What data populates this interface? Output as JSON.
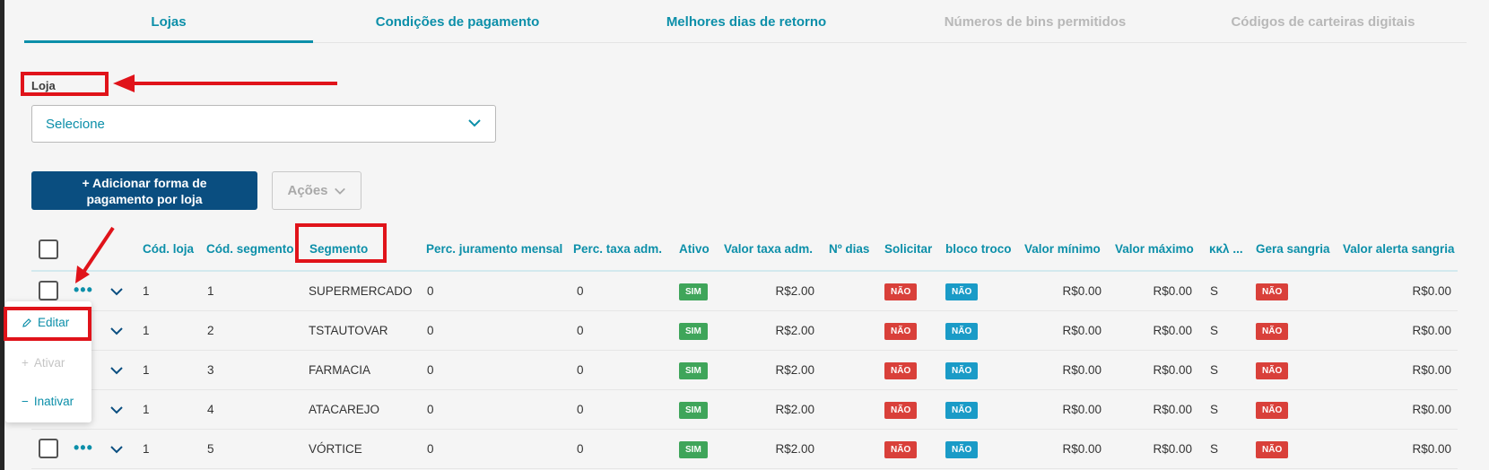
{
  "tabs": [
    {
      "label": "Lojas",
      "state": "active"
    },
    {
      "label": "Condições de pagamento",
      "state": "enabled"
    },
    {
      "label": "Melhores dias de retorno",
      "state": "enabled"
    },
    {
      "label": "Números de bins permitidos",
      "state": "disabled"
    },
    {
      "label": "Códigos de carteiras digitais",
      "state": "disabled"
    }
  ],
  "filter": {
    "label": "Loja",
    "value": "Selecione"
  },
  "actions": {
    "add_label": "+ Adicionar forma de pagamento por loja",
    "actions_label": "Ações"
  },
  "table": {
    "headers": [
      "Cód. loja",
      "Cód. segmento",
      "Segmento",
      "Perc. juramento mensal",
      "Perc. taxa adm.",
      "Ativo",
      "Valor taxa adm.",
      "Nº dias",
      "Solicitar",
      "bloco troco",
      "Valor mínimo",
      "Valor máximo",
      "κκλ ...",
      "Gera sangria",
      "Valor alerta sangria"
    ],
    "rows": [
      {
        "cod_loja": "1",
        "cod_segmento": "1",
        "segmento": "SUPERMERCADO",
        "perc_juramento": "0",
        "perc_taxa": "0",
        "ativo": "SIM",
        "valor_taxa": "R$2.00",
        "solicitar": "NÃO",
        "bloco_troco": "NÃO",
        "valor_minimo": "R$0.00",
        "valor_maximo": "R$0.00",
        "kkl": "S",
        "gera_sangria": "NÃO",
        "valor_alerta": "R$0.00"
      },
      {
        "cod_loja": "1",
        "cod_segmento": "2",
        "segmento": "TSTAUTOVAR",
        "perc_juramento": "0",
        "perc_taxa": "0",
        "ativo": "SIM",
        "valor_taxa": "R$2.00",
        "solicitar": "NÃO",
        "bloco_troco": "NÃO",
        "valor_minimo": "R$0.00",
        "valor_maximo": "R$0.00",
        "kkl": "S",
        "gera_sangria": "NÃO",
        "valor_alerta": "R$0.00"
      },
      {
        "cod_loja": "1",
        "cod_segmento": "3",
        "segmento": "FARMACIA",
        "perc_juramento": "0",
        "perc_taxa": "0",
        "ativo": "SIM",
        "valor_taxa": "R$2.00",
        "solicitar": "NÃO",
        "bloco_troco": "NÃO",
        "valor_minimo": "R$0.00",
        "valor_maximo": "R$0.00",
        "kkl": "S",
        "gera_sangria": "NÃO",
        "valor_alerta": "R$0.00"
      },
      {
        "cod_loja": "1",
        "cod_segmento": "4",
        "segmento": "ATACAREJO",
        "perc_juramento": "0",
        "perc_taxa": "0",
        "ativo": "SIM",
        "valor_taxa": "R$2.00",
        "solicitar": "NÃO",
        "bloco_troco": "NÃO",
        "valor_minimo": "R$0.00",
        "valor_maximo": "R$0.00",
        "kkl": "S",
        "gera_sangria": "NÃO",
        "valor_alerta": "R$0.00"
      },
      {
        "cod_loja": "1",
        "cod_segmento": "5",
        "segmento": "VÓRTICE",
        "perc_juramento": "0",
        "perc_taxa": "0",
        "ativo": "SIM",
        "valor_taxa": "R$2.00",
        "solicitar": "NÃO",
        "bloco_troco": "NÃO",
        "valor_minimo": "R$0.00",
        "valor_maximo": "R$0.00",
        "kkl": "S",
        "gera_sangria": "NÃO",
        "valor_alerta": "R$0.00"
      }
    ]
  },
  "row_menu": [
    {
      "label": "Editar",
      "icon": "pencil-icon",
      "enabled": true
    },
    {
      "label": "Ativar",
      "icon": "plus-icon",
      "enabled": false
    },
    {
      "label": "Inativar",
      "icon": "minus-icon",
      "enabled": true
    }
  ],
  "colors": {
    "accent": "#0c8fa9",
    "primary_button": "#0a4e80",
    "badge_sim": "#3fa55a",
    "badge_nao_red": "#d9403a",
    "badge_nao_blue": "#1a9bc7",
    "annotation": "#e0131a"
  }
}
